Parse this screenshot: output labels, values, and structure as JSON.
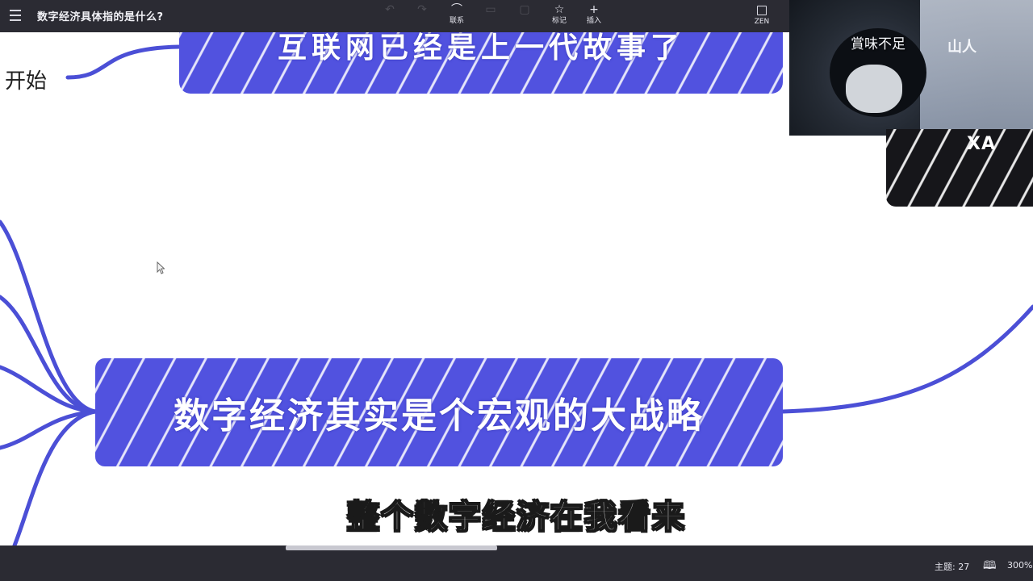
{
  "app": {
    "title": "数字经济具体指的是什么?"
  },
  "toolbar": {
    "items": [
      {
        "label": "",
        "glyph": "↶",
        "icon": "undo-icon",
        "enabled": false
      },
      {
        "label": "",
        "glyph": "↷",
        "icon": "redo-icon",
        "enabled": false
      },
      {
        "label": "联系",
        "glyph": "⌒",
        "icon": "relation-icon",
        "enabled": true
      },
      {
        "label": "",
        "glyph": "▭",
        "icon": "summary-icon",
        "enabled": false
      },
      {
        "label": "",
        "glyph": "▢",
        "icon": "boundary-icon",
        "enabled": false
      },
      {
        "label": "标记",
        "glyph": "☆",
        "icon": "marker-star-icon",
        "enabled": true
      },
      {
        "label": "插入",
        "glyph": "+",
        "icon": "insert-plus-icon",
        "enabled": true
      }
    ],
    "zen_label": "ZEN"
  },
  "mindmap": {
    "top_node": "互联网已经是上一代故事了",
    "main_node": "数字经济其实是个宏观的大战略",
    "side_label": "开始"
  },
  "subtitle": "整个数字经济在我看来",
  "webcam": {
    "caption": "賞味不足",
    "right_text": "山人",
    "lower_text": "XA"
  },
  "status": {
    "topics": "主题: 27",
    "zoom": "300%"
  },
  "colors": {
    "node": "#5152df",
    "line": "#4b4fd6",
    "chrome": "#2b2b33"
  }
}
